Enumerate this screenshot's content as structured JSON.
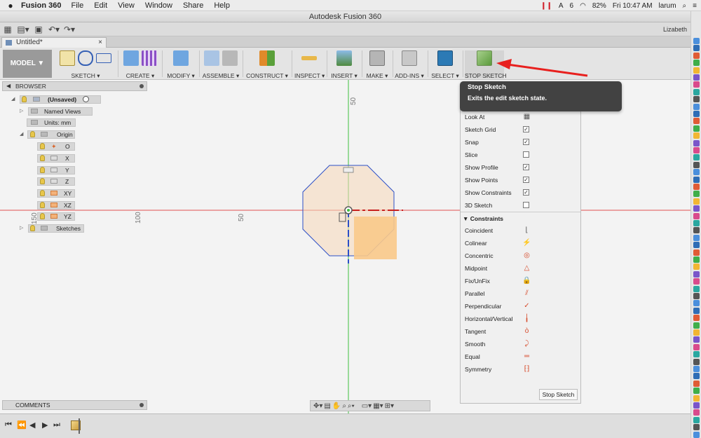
{
  "menubar": {
    "app_name": "Fusion 360",
    "items": [
      "File",
      "Edit",
      "View",
      "Window",
      "Share",
      "Help"
    ],
    "tray_badge": "6",
    "battery": "82%",
    "clock": "Fri 10:47 AM",
    "user": "larum"
  },
  "window": {
    "title": "Autodesk Fusion 360"
  },
  "qabar": {
    "user_name": "Lizabeth"
  },
  "document": {
    "tab_title": "Untitled*",
    "close": "×"
  },
  "ribbon": {
    "workspace": "MODEL ▼",
    "groups": [
      {
        "label": "SKETCH ▾"
      },
      {
        "label": "CREATE ▾"
      },
      {
        "label": "MODIFY ▾"
      },
      {
        "label": "ASSEMBLE ▾"
      },
      {
        "label": "CONSTRUCT ▾"
      },
      {
        "label": "INSPECT ▾"
      },
      {
        "label": "INSERT ▾"
      },
      {
        "label": "MAKE ▾"
      },
      {
        "label": "ADD-INS ▾"
      },
      {
        "label": "SELECT ▾"
      },
      {
        "label": "STOP SKETCH"
      }
    ]
  },
  "browser": {
    "title": "BROWSER",
    "root": "(Unsaved)",
    "named_views": "Named Views",
    "units": "Units: mm",
    "origin": "Origin",
    "origin_items": [
      "O",
      "X",
      "Y",
      "Z",
      "XY",
      "XZ",
      "YZ"
    ],
    "sketches": "Sketches"
  },
  "canvas": {
    "ruler_labels": [
      "50",
      "100",
      "150",
      "50"
    ]
  },
  "tooltip": {
    "title": "Stop Sketch",
    "description": "Exits the edit sketch state."
  },
  "sketch_palette": {
    "options": [
      {
        "label": "Look At",
        "type": "icon",
        "checked": false
      },
      {
        "label": "Sketch Grid",
        "type": "checkbox",
        "checked": true
      },
      {
        "label": "Snap",
        "type": "checkbox",
        "checked": true
      },
      {
        "label": "Slice",
        "type": "checkbox",
        "checked": false
      },
      {
        "label": "Show Profile",
        "type": "checkbox",
        "checked": true
      },
      {
        "label": "Show Points",
        "type": "checkbox",
        "checked": true
      },
      {
        "label": "Show Constraints",
        "type": "checkbox",
        "checked": true
      },
      {
        "label": "3D Sketch",
        "type": "checkbox",
        "checked": false
      }
    ],
    "constraints_title": "Constraints",
    "constraints": [
      {
        "label": "Coincident",
        "icon": "coincident-icon",
        "glyph": "⌊",
        "color": "#555555"
      },
      {
        "label": "Colinear",
        "icon": "colinear-icon",
        "glyph": "⚡",
        "color": "#555555"
      },
      {
        "label": "Concentric",
        "icon": "concentric-icon",
        "glyph": "◎",
        "color": "#d64a2a"
      },
      {
        "label": "Midpoint",
        "icon": "midpoint-icon",
        "glyph": "△",
        "color": "#d64a2a"
      },
      {
        "label": "Fix/UnFix",
        "icon": "lock-icon",
        "glyph": "🔒",
        "color": "#d64a2a"
      },
      {
        "label": "Parallel",
        "icon": "parallel-icon",
        "glyph": "⫽",
        "color": "#d64a2a"
      },
      {
        "label": "Perpendicular",
        "icon": "perpendicular-icon",
        "glyph": "✓",
        "color": "#d64a2a"
      },
      {
        "label": "Horizontal/Vertical",
        "icon": "horizontal-vertical-icon",
        "glyph": "╽",
        "color": "#d64a2a"
      },
      {
        "label": "Tangent",
        "icon": "tangent-icon",
        "glyph": "ò",
        "color": "#d64a2a"
      },
      {
        "label": "Smooth",
        "icon": "smooth-icon",
        "glyph": "⤸",
        "color": "#d64a2a"
      },
      {
        "label": "Equal",
        "icon": "equal-icon",
        "glyph": "═",
        "color": "#d64a2a"
      },
      {
        "label": "Symmetry",
        "icon": "symmetry-icon",
        "glyph": "⁅⁆",
        "color": "#d64a2a"
      }
    ],
    "stop_button": "Stop Sketch"
  },
  "comments": {
    "title": "COMMENTS"
  },
  "colors": {
    "accent": "#2f6db5",
    "sketch_line": "#2b4fc7",
    "profile_fill": "#f6d7b8",
    "axis_red": "#e05050",
    "axis_green": "#3fbf3f",
    "arrow": "#e8201e"
  }
}
